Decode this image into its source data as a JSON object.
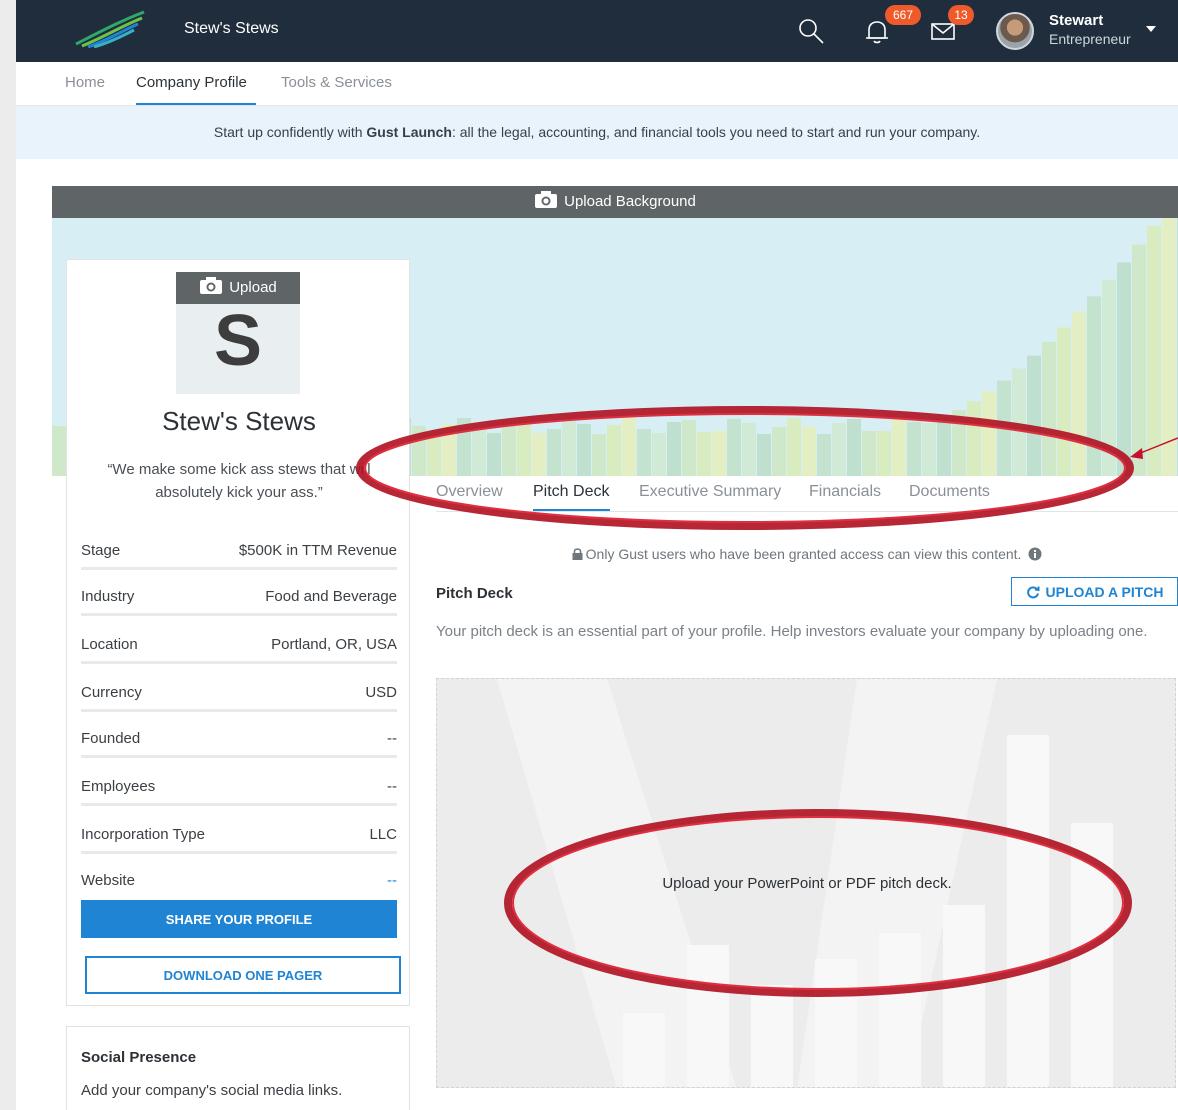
{
  "topnav": {
    "app_name": "Stew's Stews",
    "notifications_count": "667",
    "messages_count": "13",
    "user_name": "Stewart",
    "user_role": "Entrepreneur"
  },
  "subnav": {
    "items": [
      "Home",
      "Company Profile",
      "Tools & Services"
    ]
  },
  "banner": {
    "prefix": "Start up confidently with ",
    "brand": "Gust Launch",
    "suffix": ": all the legal, accounting, and financial tools you need to start and run your company."
  },
  "hero": {
    "upload_background": "Upload Background"
  },
  "profile": {
    "upload_label": "Upload",
    "logo_letter": "S",
    "company_name": "Stew's Stews",
    "tagline": "“We make some kick ass stews that will absolutely kick your ass.”",
    "facts": [
      {
        "key": "Stage",
        "value": "$500K in TTM Revenue"
      },
      {
        "key": "Industry",
        "value": "Food and Beverage"
      },
      {
        "key": "Location",
        "value": "Portland, OR, USA"
      },
      {
        "key": "Currency",
        "value": "USD"
      },
      {
        "key": "Founded",
        "value": "--"
      },
      {
        "key": "Employees",
        "value": "--"
      },
      {
        "key": "Incorporation Type",
        "value": "LLC"
      },
      {
        "key": "Website",
        "value": "--"
      }
    ],
    "share_button": "SHARE YOUR PROFILE",
    "download_button": "DOWNLOAD ONE PAGER"
  },
  "social": {
    "title": "Social Presence",
    "text": "Add your company's social media links."
  },
  "tabs": [
    "Overview",
    "Pitch Deck",
    "Executive Summary",
    "Financials",
    "Documents"
  ],
  "pitch": {
    "access_note": "Only Gust users who have been granted access can view this content.",
    "title": "Pitch Deck",
    "upload_button": "UPLOAD A PITCH",
    "description": "Your pitch deck is an essential part of your profile. Help investors evaluate your company by uploading one.",
    "dropzone_text": "Upload your PowerPoint or PDF pitch deck."
  },
  "colors": {
    "nav_bg": "#1f2d3d",
    "accent": "#1f84d3",
    "badge": "#ef5a2a",
    "annotation": "#c8102e"
  }
}
